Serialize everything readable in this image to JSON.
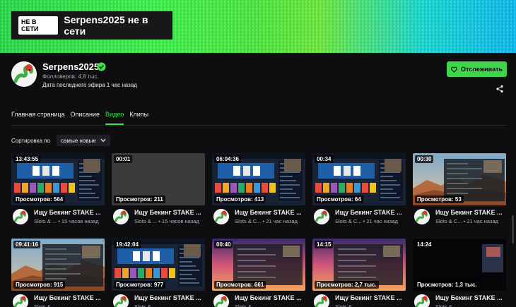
{
  "banner": {
    "offline_badge": "НЕ В СЕТИ",
    "offline_text": "Serpens2025 не в сети"
  },
  "channel": {
    "name": "Serpens2025",
    "followers": "Фолловеров: 4,8 тыс.",
    "last_stream": "Дата последнего эфира 1 час назад"
  },
  "follow_button": {
    "label": "Отслеживать"
  },
  "tabs": [
    {
      "label": "Главная страница"
    },
    {
      "label": "Описание"
    },
    {
      "label": "Видео"
    },
    {
      "label": "Клипы"
    }
  ],
  "sort": {
    "label": "Сортировка по",
    "value": "самые новые"
  },
  "videos": [
    {
      "duration": "13:43:55",
      "views": "Просмотров: 564",
      "title": "Ищу Бекинг STAKE ...",
      "category": "Slots & ...",
      "age": "• 15 часов назад"
    },
    {
      "duration": "00:01",
      "views": "Просмотров: 211",
      "title": "Ищу Бекинг STAKE ...",
      "category": "Slots & ...",
      "age": "• 15 часов назад"
    },
    {
      "duration": "06:04:36",
      "views": "Просмотров: 413",
      "title": "Ищу Бекинг STAKE ...",
      "category": "Slots & C...",
      "age": "• 21 час назад"
    },
    {
      "duration": "00:34",
      "views": "Просмотров: 64",
      "title": "Ищу Бекинг STAKE ...",
      "category": "Slots & C...",
      "age": "• 21 час назад"
    },
    {
      "duration": "00:30",
      "views": "Просмотров: 53",
      "title": "Ищу Бекинг STAKE ...",
      "category": "Slots & C...",
      "age": "• 21 час назад"
    },
    {
      "duration": "09:41:16",
      "views": "Просмотров: 915",
      "title": "Ищу Бекинг STAKE ...",
      "category": "Slots & ...",
      "age": ""
    },
    {
      "duration": "19:42:04",
      "views": "Просмотров: 977",
      "title": "Ищу Бекинг STAKE ...",
      "category": "Slots & ...",
      "age": ""
    },
    {
      "duration": "00:40",
      "views": "Просмотров: 661",
      "title": "Ищу Бекинг STAKE ...",
      "category": "Slots & ...",
      "age": ""
    },
    {
      "duration": "14:15",
      "views": "Просмотров: 2,7 тыс.",
      "title": "Ищу Бекинг STAKE ...",
      "category": "Slots & ...",
      "age": ""
    },
    {
      "duration": "14:24",
      "views": "Просмотров: 1,3 тыс.",
      "title": "Ищу Бекинг STAKE ...",
      "category": "Slots & ...",
      "age": ""
    }
  ],
  "colors": {
    "accent": "#3fe24b",
    "background": "#0e0e10",
    "follow_button": "#3fd54a"
  }
}
